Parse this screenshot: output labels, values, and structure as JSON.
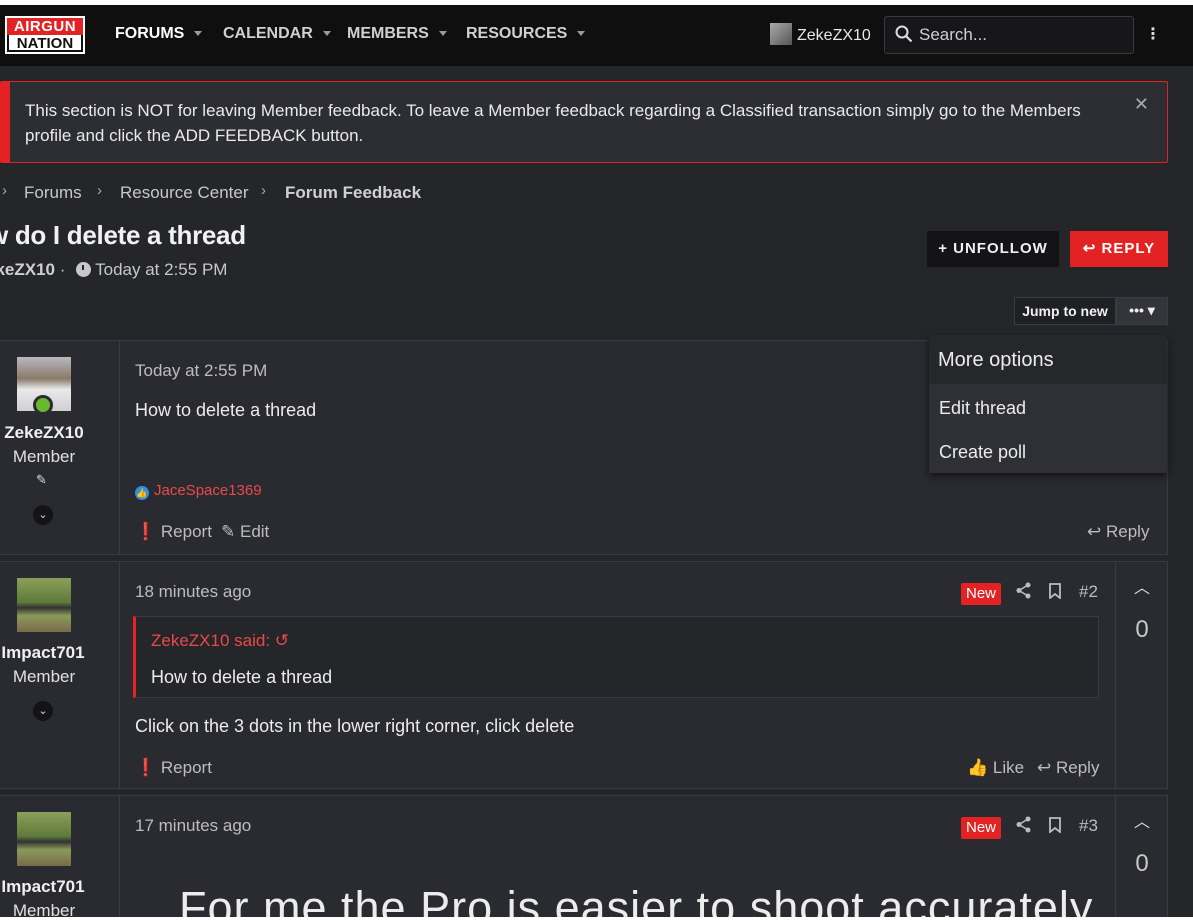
{
  "nav": {
    "logo_line1": "AIRGUN",
    "logo_line2": "NATION",
    "items": [
      {
        "label": "FORUMS"
      },
      {
        "label": "CALENDAR"
      },
      {
        "label": "MEMBERS"
      },
      {
        "label": "RESOURCES"
      }
    ],
    "username": "ZekeZX10",
    "search_placeholder": "Search...",
    "more_icon": "vertical-dots-icon"
  },
  "notice": {
    "text": "This section is NOT for leaving Member feedback. To leave a Member feedback regarding a Classified transaction simply go to the Members profile and click the ADD FEEDBACK button.",
    "close": "✕"
  },
  "breadcrumb": [
    "Forums",
    "Resource Center",
    "Forum Feedback"
  ],
  "thread": {
    "title": "w do I delete a thread",
    "author": "ekeZX10",
    "separator": "·",
    "time": "Today at 2:55 PM",
    "unfollow_label": "+ UNFOLLOW",
    "reply_label": "REPLY",
    "jump_label": "Jump to new",
    "more_label": "•••"
  },
  "menu": {
    "header": "More options",
    "items": [
      "Edit thread",
      "Create poll"
    ]
  },
  "posts": [
    {
      "author": "ZekeZX10",
      "role": "Member",
      "time": "Today at 2:55 PM",
      "body": "How to delete a thread",
      "reactor": "JaceSpace1369",
      "report": "Report",
      "edit": "Edit",
      "reply": "Reply"
    },
    {
      "author": "Impact701",
      "role": "Member",
      "time": "18 minutes ago",
      "new_badge": "New",
      "number": "#2",
      "quote_author": "ZekeZX10 said:",
      "quote_body": "How to delete a thread",
      "body": "Click on the 3 dots in the lower right corner, click delete",
      "report": "Report",
      "like": "Like",
      "reply": "Reply",
      "votes": "0"
    },
    {
      "author": "Impact701",
      "role": "Member",
      "time": "17 minutes ago",
      "new_badge": "New",
      "number": "#3",
      "body": "For me the Pro is easier to shoot accurately",
      "votes": "0"
    }
  ]
}
